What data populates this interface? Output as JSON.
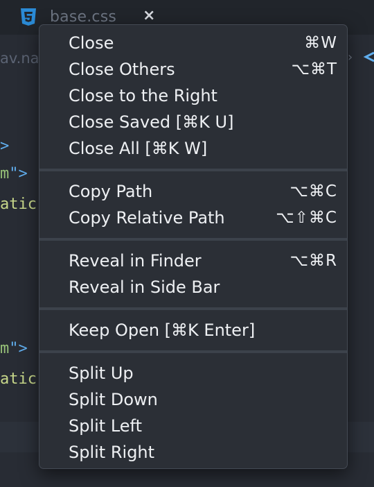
{
  "tab": {
    "title": "base.css",
    "close_glyph": "×",
    "icon_color": "#2b8bd6"
  },
  "breadcrumb": {
    "fragment": "av.na"
  },
  "code_lines": [
    {
      "text": ">"
    },
    {
      "text_a": "m",
      "text_b": "\">"
    },
    {
      "text": "atic"
    },
    {
      "text_a": "m",
      "text_b": "\">"
    },
    {
      "text": "atic"
    }
  ],
  "context_menu": {
    "groups": [
      [
        {
          "label": "Close",
          "shortcut": "⌘W"
        },
        {
          "label": "Close Others",
          "shortcut": "⌥⌘T"
        },
        {
          "label": "Close to the Right",
          "shortcut": ""
        },
        {
          "label": "Close Saved [⌘K U]",
          "shortcut": ""
        },
        {
          "label": "Close All [⌘K W]",
          "shortcut": ""
        }
      ],
      [
        {
          "label": "Copy Path",
          "shortcut": "⌥⌘C"
        },
        {
          "label": "Copy Relative Path",
          "shortcut": "⌥⇧⌘C"
        }
      ],
      [
        {
          "label": "Reveal in Finder",
          "shortcut": "⌥⌘R"
        },
        {
          "label": "Reveal in Side Bar",
          "shortcut": ""
        }
      ],
      [
        {
          "label": "Keep Open [⌘K Enter]",
          "shortcut": ""
        }
      ],
      [
        {
          "label": "Split Up",
          "shortcut": ""
        },
        {
          "label": "Split Down",
          "shortcut": ""
        },
        {
          "label": "Split Left",
          "shortcut": ""
        },
        {
          "label": "Split Right",
          "shortcut": ""
        }
      ]
    ]
  },
  "colors": {
    "menu_bg": "#2b2f36",
    "menu_text": "#eef0f3",
    "editor_bg": "#282c34"
  }
}
